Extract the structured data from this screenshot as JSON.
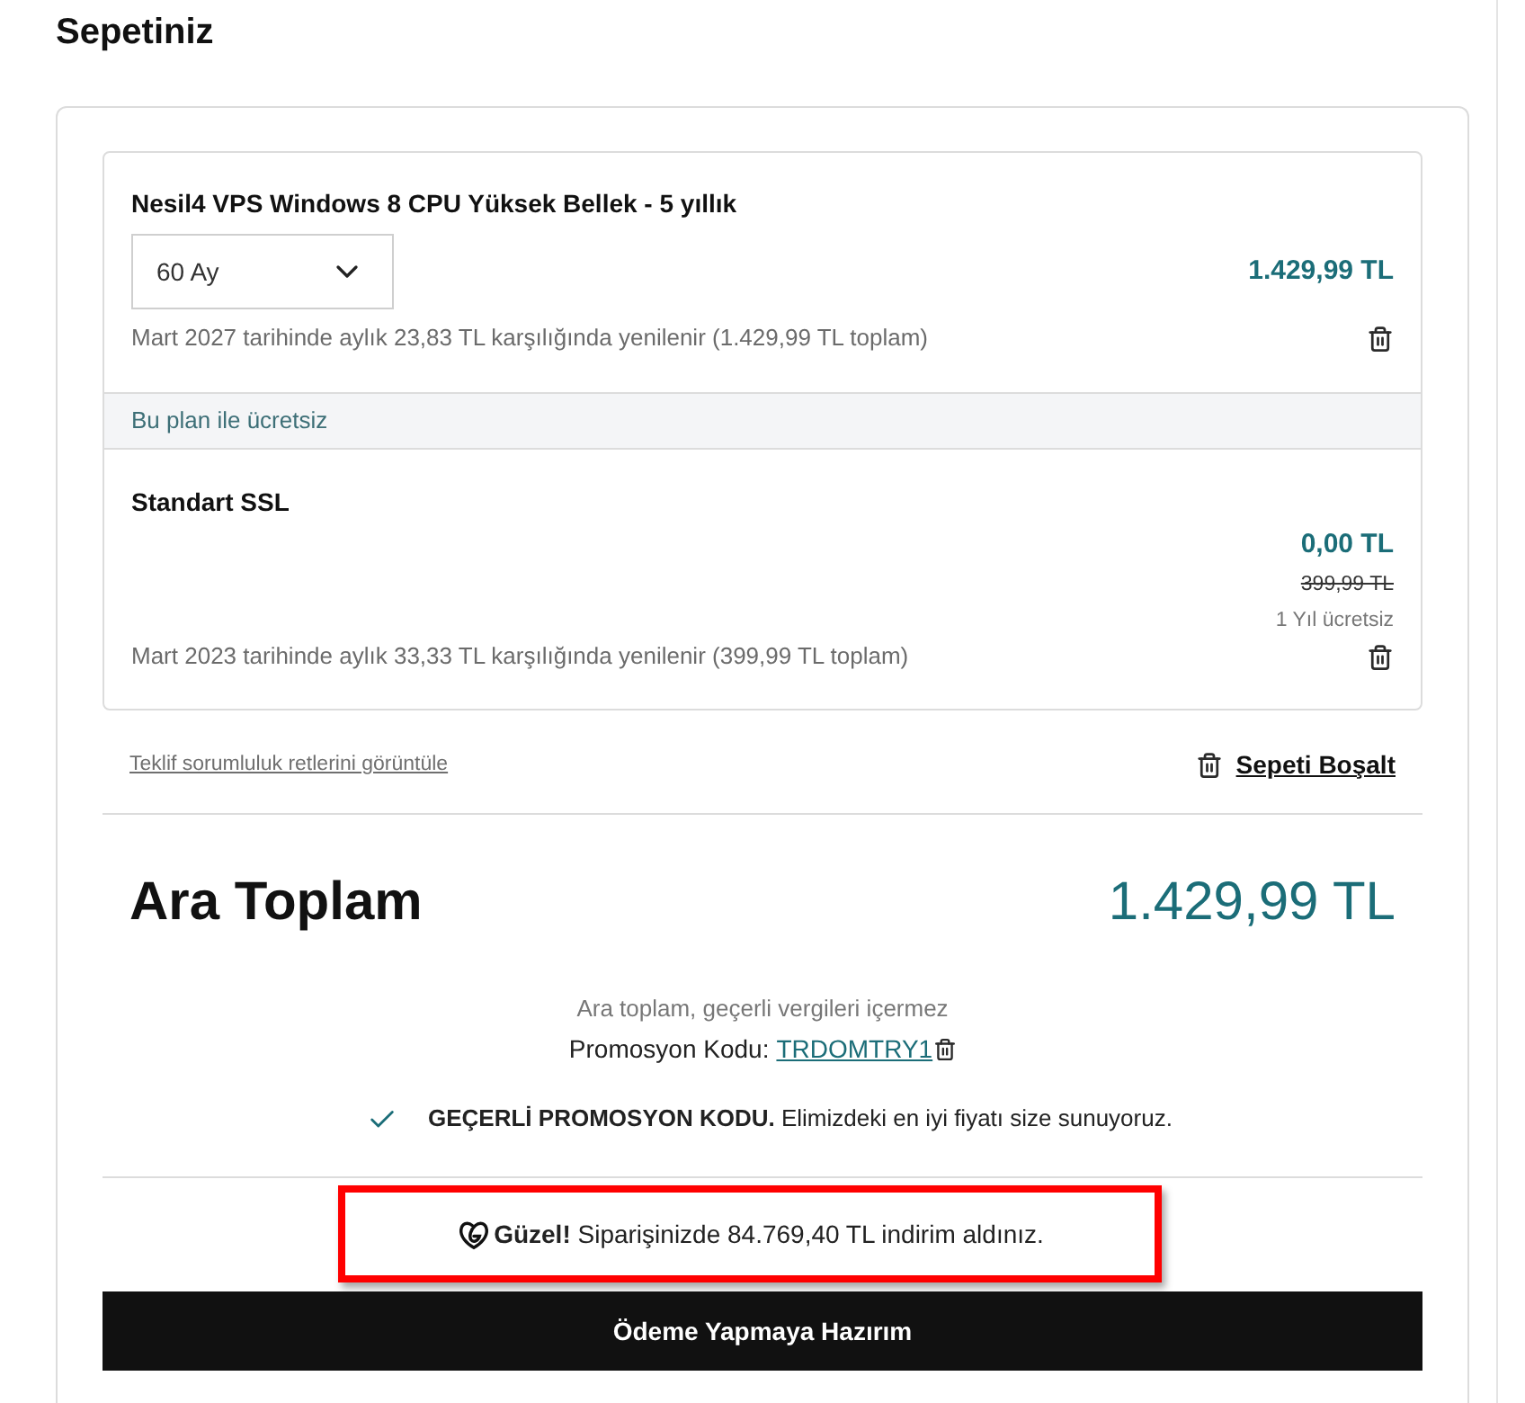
{
  "page_title": "Sepetiniz",
  "cart_items": [
    {
      "kind": "product",
      "title": "Nesil4 VPS Windows 8 CPU Yüksek Bellek - 5 yıllık",
      "term": "60 Ay",
      "price": "1.429,99 TL",
      "renewal_note": "Mart 2027 tarihinde aylık 23,83 TL karşılığında yenilenir (1.429,99 TL toplam)"
    },
    {
      "kind": "bundled",
      "section_label": "Bu plan ile ücretsiz",
      "title": "Standart SSL",
      "price": "0,00 TL",
      "original_price": "399,99 TL",
      "free_period": "1 Yıl ücretsiz",
      "renewal_note": "Mart 2023 tarihinde aylık 33,33 TL karşılığında yenilenir (399,99 TL toplam)"
    }
  ],
  "disclaimers_link": "Teklif sorumluluk retlerini görüntüle",
  "empty_cart_button": "Sepeti Boşalt",
  "subtotal": {
    "label": "Ara Toplam",
    "amount": "1.429,99 TL",
    "tax_note": "Ara toplam, geçerli vergileri içermez",
    "promo_label": "Promosyon Kodu:",
    "promo_code": "TRDOMTRY1"
  },
  "promo_status": {
    "message": "**GEÇERLİ PROMOSYON KODU.** Elimizdeki en iyi fiyatı size sunuyoruz."
  },
  "savings_banner": {
    "message": "**Güzel!** Siparişinizde 84.769,40 TL indirim aldınız."
  },
  "checkout_button": "Ödeme Yapmaya Hazırım"
}
